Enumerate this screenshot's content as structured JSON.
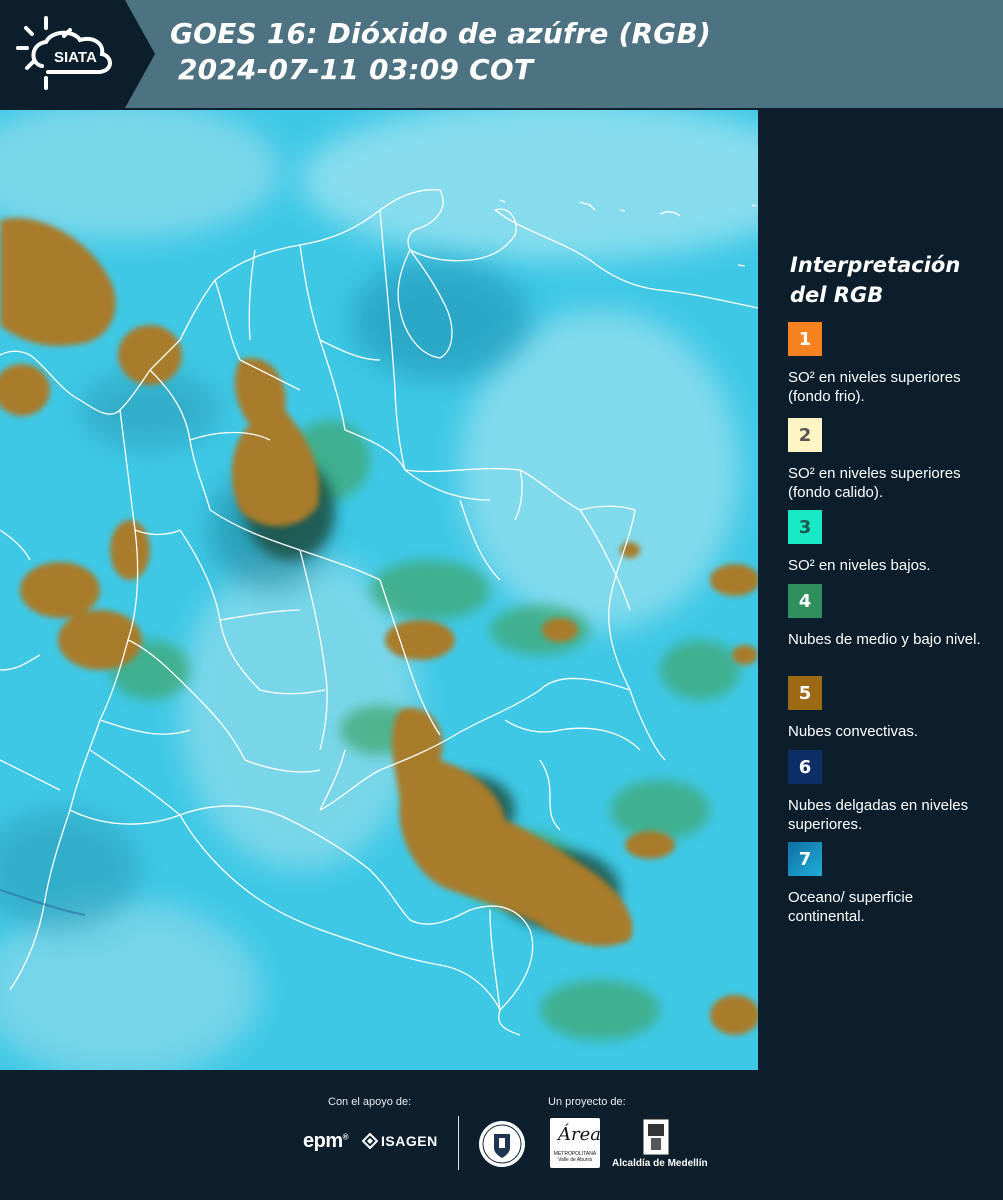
{
  "header": {
    "logo_text": "SIATA",
    "title_line1": "GOES 16: Dióxido de azúfre (RGB)",
    "title_line2": "2024-07-11 03:09 COT"
  },
  "legend": {
    "title_line1": "Interpretación",
    "title_line2": "del RGB",
    "items": [
      {
        "number": "1",
        "label": "SO² en niveles superiores (fondo frio).",
        "color": "#f5811f"
      },
      {
        "number": "2",
        "label": "SO² en niveles superiores (fondo calido).",
        "color": "#fdf6c4"
      },
      {
        "number": "3",
        "label": "SO² en niveles bajos.",
        "color": "#19e8c4"
      },
      {
        "number": "4",
        "label": "Nubes de medio y bajo nivel.",
        "color": "#2f8f5d"
      },
      {
        "number": "5",
        "label": "Nubes convectivas.",
        "color": "#9c6914"
      },
      {
        "number": "6",
        "label": "Nubes delgadas en niveles superiores.",
        "color": "#0e2f66"
      },
      {
        "number": "7",
        "label": "Oceano/ superficie continental.",
        "color": "#1a8fbd"
      }
    ]
  },
  "footer": {
    "support_label": "Con el apoyo de:",
    "project_label": "Un proyecto de:",
    "sponsor_1": "epm",
    "sponsor_2": "ISAGEN",
    "partner_1": "Medellín",
    "partner_2_mark": "Área",
    "partner_2_name": "METROPOLITANA Valle de Aburrá",
    "partner_3": "Alcaldía de Medellín"
  },
  "map": {
    "colors": {
      "background": "#3fc9e6",
      "convective": "#a87b2c",
      "low_mid": "#3fa56a",
      "border": "#ffffff"
    }
  }
}
